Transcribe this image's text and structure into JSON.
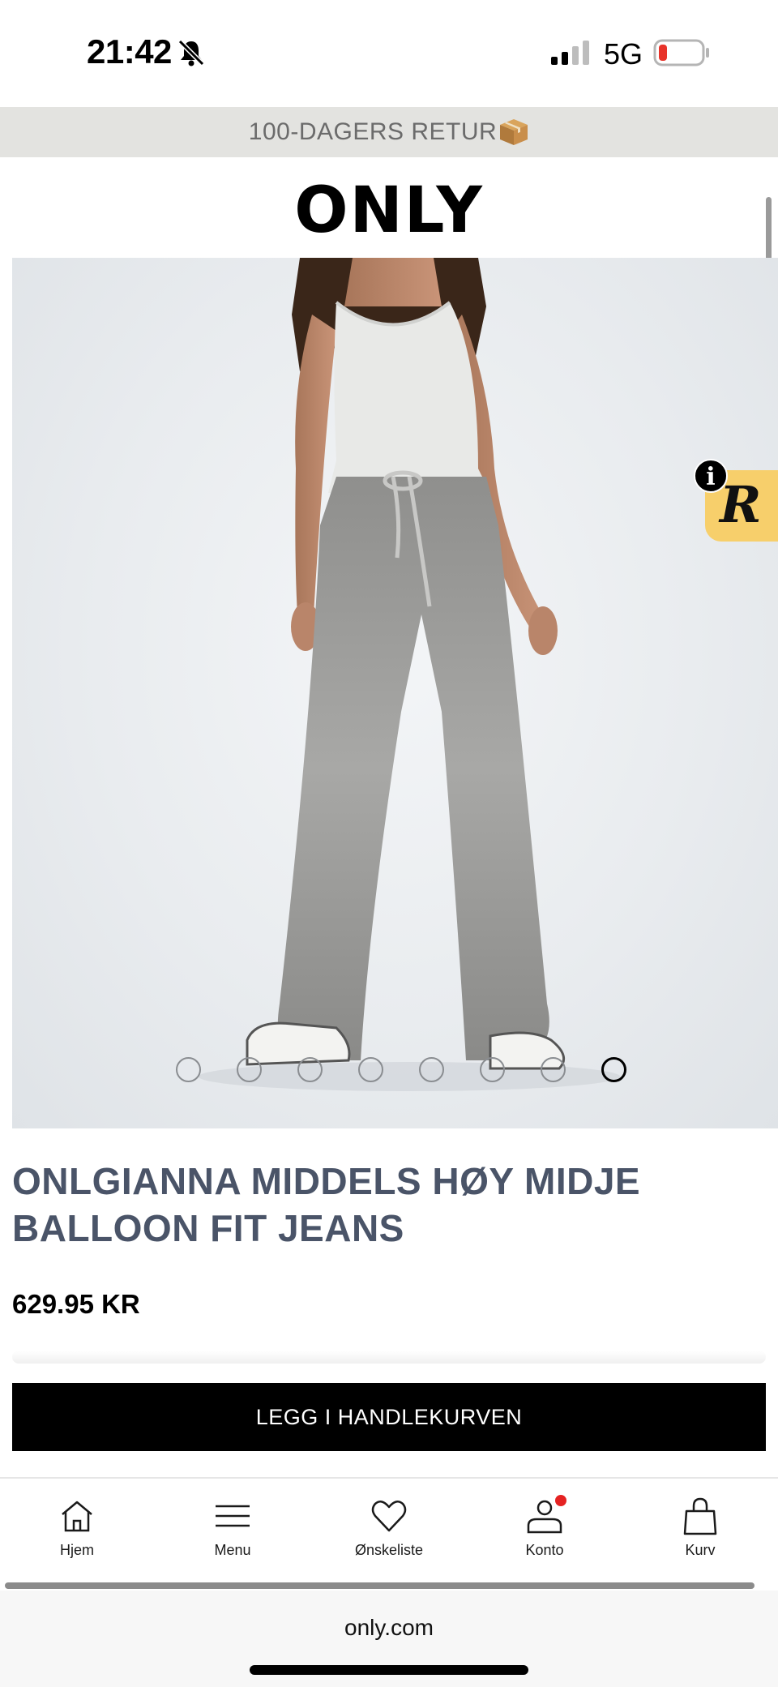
{
  "status_bar": {
    "time": "21:42",
    "network": "5G",
    "icons": [
      "bell-slash-icon",
      "signal-icon",
      "battery-low-icon"
    ]
  },
  "promo": {
    "text": "100-DAGERS RETUR",
    "icon": "package-icon"
  },
  "brand": {
    "logo_text": "ONLY"
  },
  "gallery": {
    "image_count": 8,
    "active_index": 7
  },
  "widget": {
    "letter": "R",
    "info_symbol": "i",
    "color": "#f7cf6b"
  },
  "product": {
    "title": "ONLGIANNA MIDDELS HØY MIDJE BALLOON FIT JEANS",
    "price": "629.95 KR",
    "title_color": "#4a5468"
  },
  "cart_button": {
    "label": "LEGG I HANDLEKURVEN"
  },
  "bottom_nav": {
    "items": [
      {
        "label": "Hjem",
        "icon": "home-icon"
      },
      {
        "label": "Menu",
        "icon": "menu-icon"
      },
      {
        "label": "Ønskeliste",
        "icon": "heart-icon"
      },
      {
        "label": "Konto",
        "icon": "account-icon",
        "notification": true
      },
      {
        "label": "Kurv",
        "icon": "bag-icon"
      }
    ]
  },
  "browser": {
    "url": "only.com"
  }
}
